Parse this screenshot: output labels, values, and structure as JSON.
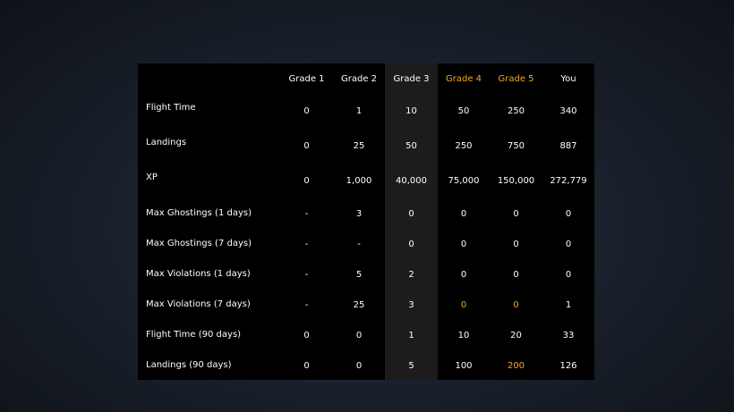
{
  "accent_color": "#f5a623",
  "table": {
    "columns": [
      {
        "label": "Grade 1",
        "accent": false
      },
      {
        "label": "Grade 2",
        "accent": false
      },
      {
        "label": "Grade 3",
        "accent": false
      },
      {
        "label": "Grade 4",
        "accent": true
      },
      {
        "label": "Grade 5",
        "accent": true
      },
      {
        "label": "You",
        "accent": false
      }
    ],
    "rows": [
      {
        "label": "Flight Time",
        "values": [
          "0",
          "1",
          "10",
          "50",
          "250",
          "340"
        ],
        "accent_cells": []
      },
      {
        "label": "Landings",
        "values": [
          "0",
          "25",
          "50",
          "250",
          "750",
          "887"
        ],
        "accent_cells": []
      },
      {
        "label": "XP",
        "values": [
          "0",
          "1,000",
          "40,000",
          "75,000",
          "150,000",
          "272,779"
        ],
        "accent_cells": []
      },
      {
        "label": "Max Ghostings (1 days)",
        "values": [
          "-",
          "3",
          "0",
          "0",
          "0",
          "0"
        ],
        "accent_cells": []
      },
      {
        "label": "Max Ghostings (7 days)",
        "values": [
          "-",
          "-",
          "0",
          "0",
          "0",
          "0"
        ],
        "accent_cells": []
      },
      {
        "label": "Max Violations (1 days)",
        "values": [
          "-",
          "5",
          "2",
          "0",
          "0",
          "0"
        ],
        "accent_cells": []
      },
      {
        "label": "Max Violations (7 days)",
        "values": [
          "-",
          "25",
          "3",
          "0",
          "0",
          "1"
        ],
        "accent_cells": [
          3,
          4
        ]
      },
      {
        "label": "Flight Time (90 days)",
        "values": [
          "0",
          "0",
          "1",
          "10",
          "20",
          "33"
        ],
        "accent_cells": []
      },
      {
        "label": "Landings (90 days)",
        "values": [
          "0",
          "0",
          "5",
          "100",
          "200",
          "126"
        ],
        "accent_cells": [
          4
        ]
      }
    ]
  }
}
